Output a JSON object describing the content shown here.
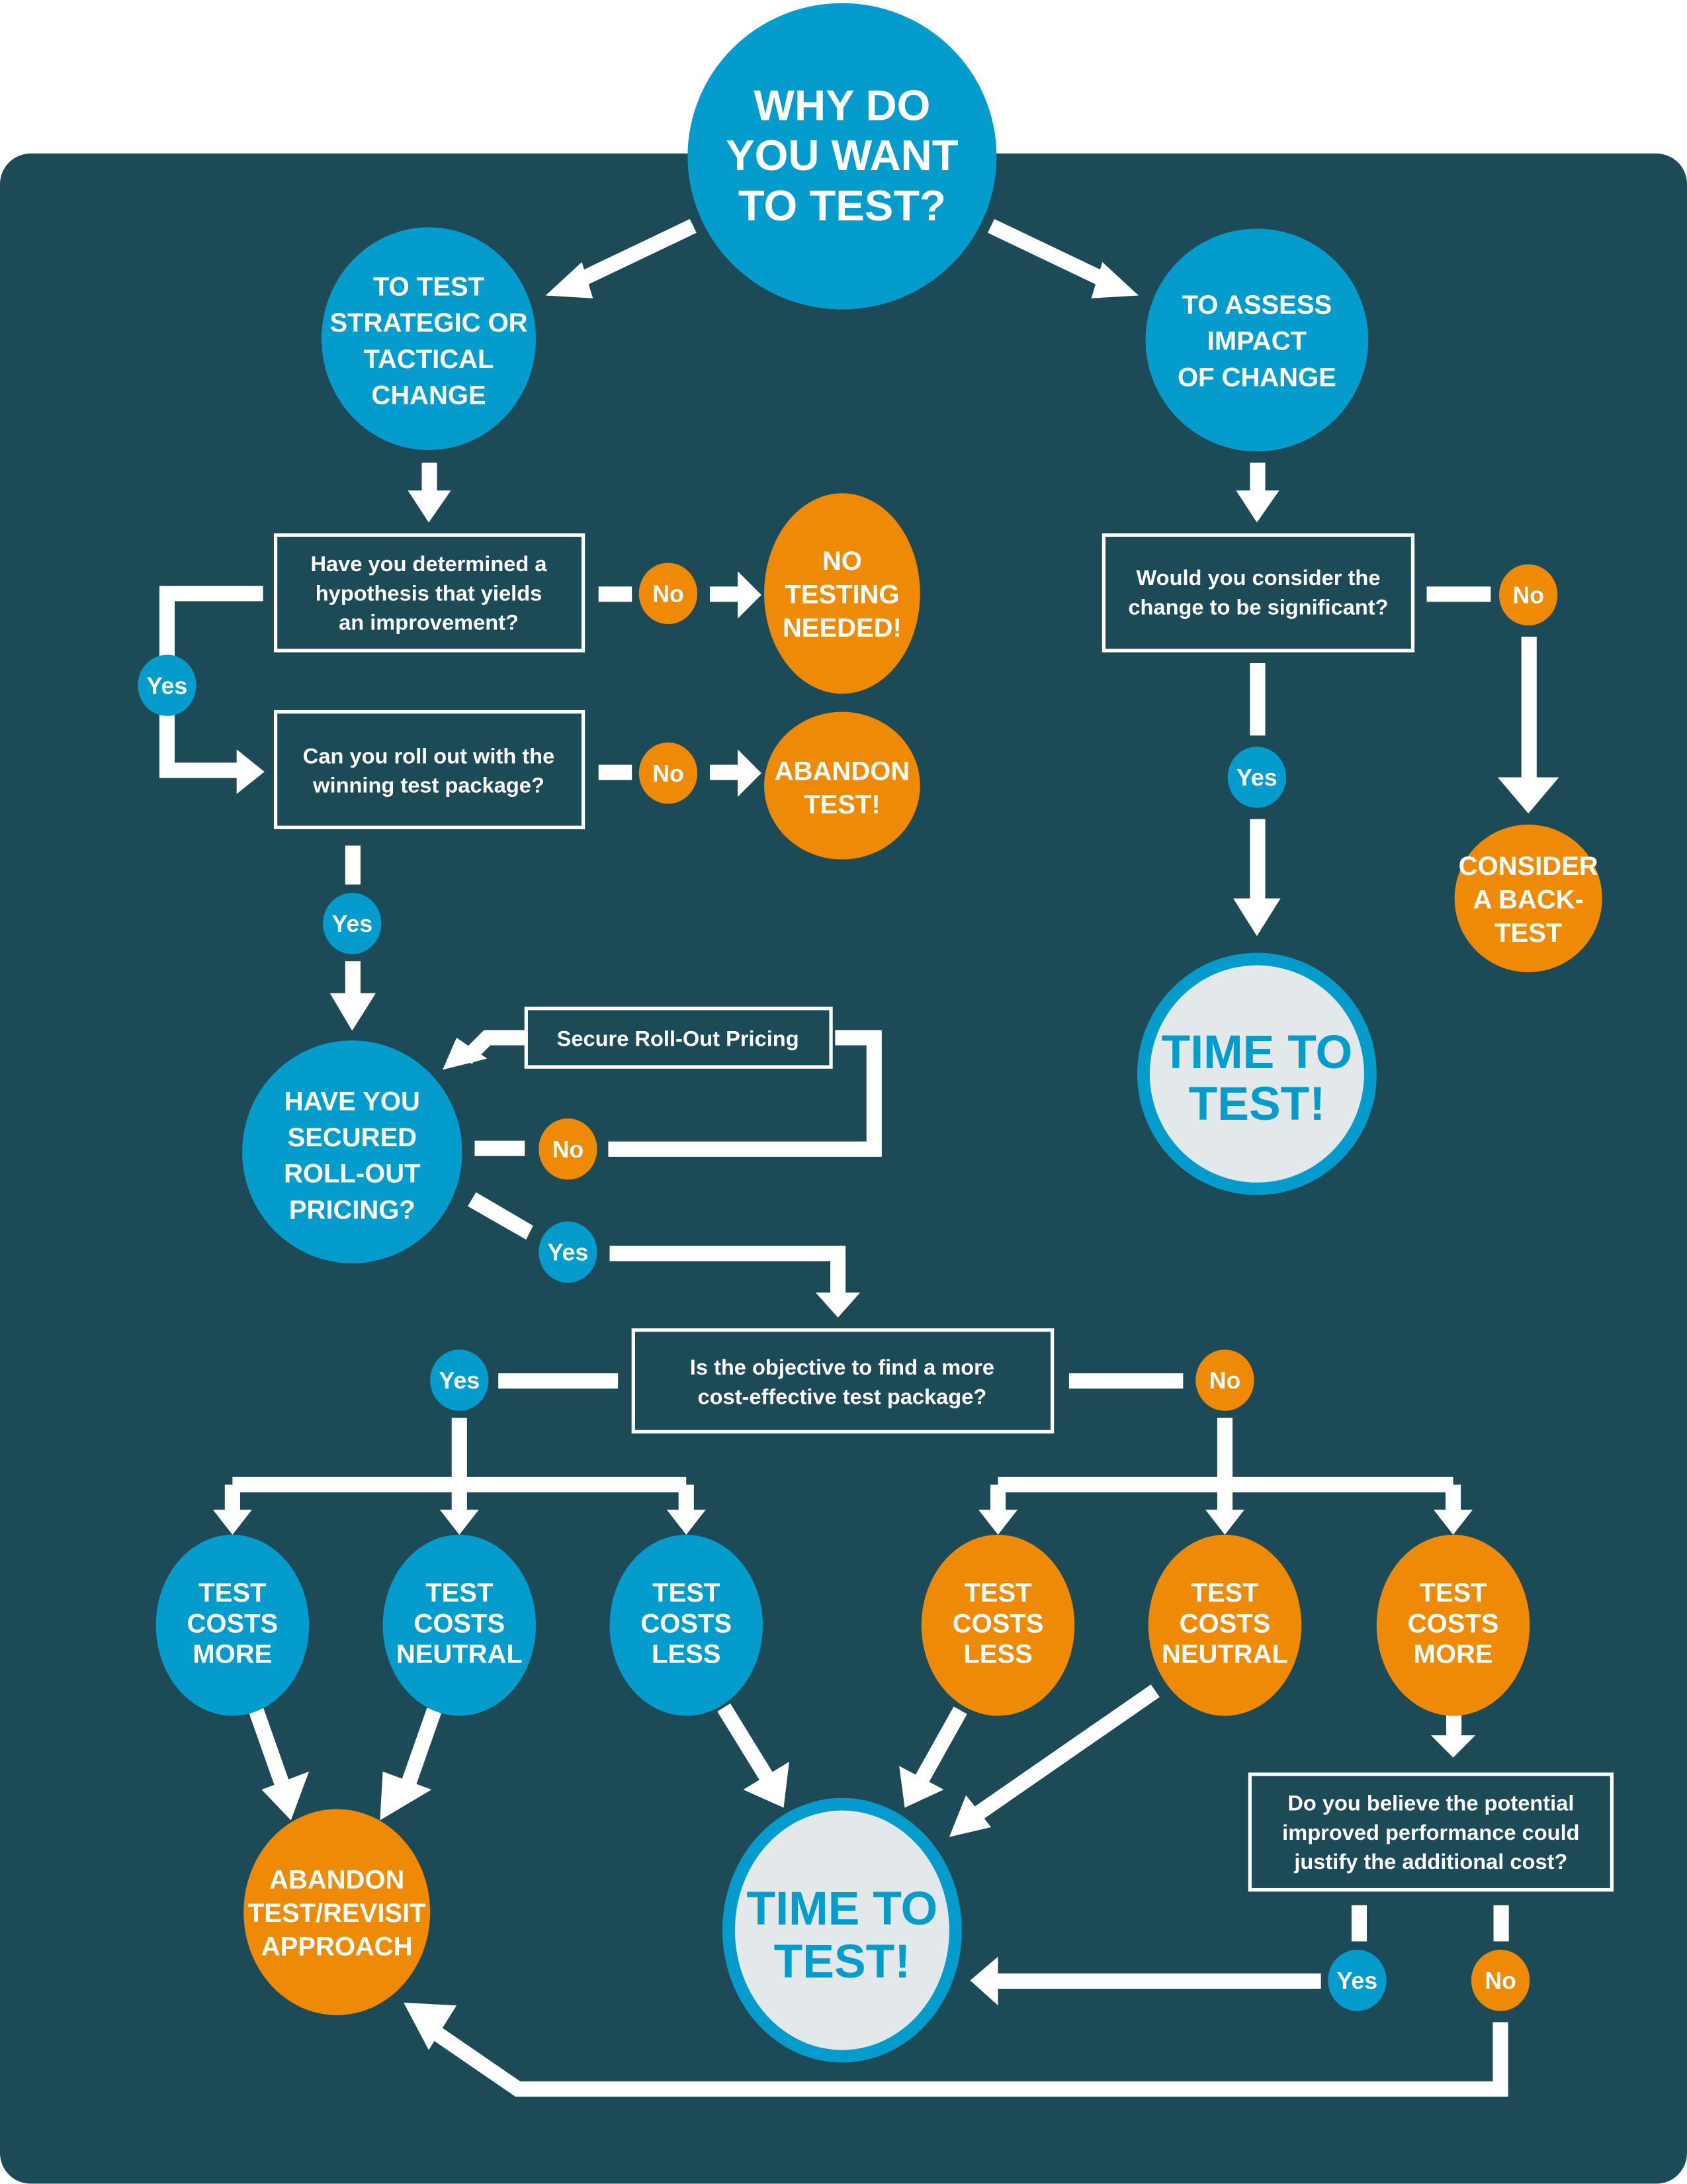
{
  "colors": {
    "background": "#1c4a57",
    "blue": "#039ccc",
    "orange": "#ef8a07",
    "light": "#e3e8eb",
    "white": "#ffffff"
  },
  "start": {
    "lines": [
      "WHY DO",
      "YOU WANT",
      "TO TEST?"
    ]
  },
  "branch_left": {
    "lines": [
      "TO TEST",
      "STRATEGIC OR",
      "TACTICAL",
      "CHANGE"
    ]
  },
  "branch_right": {
    "lines": [
      "TO ASSESS",
      "IMPACT",
      "OF CHANGE"
    ]
  },
  "q_hypothesis": {
    "lines": [
      "Have you determined a",
      "hypothesis that yields",
      "an improvement?"
    ]
  },
  "q_rollout": {
    "lines": [
      "Can you roll out with the",
      "winning test package?"
    ]
  },
  "q_significant": {
    "lines": [
      "Would you consider the",
      "change to be significant?"
    ]
  },
  "q_objective": {
    "lines": [
      "Is the objective to find a more",
      "cost-effective test package?"
    ]
  },
  "q_justify": {
    "lines": [
      "Do you believe the potential",
      "improved performance could",
      "justify the additional cost?"
    ]
  },
  "secure_box": {
    "label": "Secure Roll-Out Pricing"
  },
  "no_testing": {
    "lines": [
      "NO",
      "TESTING",
      "NEEDED!"
    ]
  },
  "abandon_test": {
    "lines": [
      "ABANDON",
      "TEST!"
    ]
  },
  "consider_backtest": {
    "lines": [
      "CONSIDER",
      "A BACK-",
      "TEST"
    ]
  },
  "time_to_test_1": {
    "lines": [
      "TIME TO",
      "TEST!"
    ]
  },
  "time_to_test_2": {
    "lines": [
      "TIME TO",
      "TEST!"
    ]
  },
  "secured_pricing": {
    "lines": [
      "HAVE YOU",
      "SECURED",
      "ROLL-OUT",
      "PRICING?"
    ]
  },
  "abandon_revisit": {
    "lines": [
      "ABANDON",
      "TEST/REVISIT",
      "APPROACH"
    ]
  },
  "blue_outcomes": [
    {
      "lines": [
        "TEST",
        "COSTS",
        "MORE"
      ]
    },
    {
      "lines": [
        "TEST",
        "COSTS",
        "NEUTRAL"
      ]
    },
    {
      "lines": [
        "TEST",
        "COSTS",
        "LESS"
      ]
    }
  ],
  "orange_outcomes": [
    {
      "lines": [
        "TEST",
        "COSTS",
        "LESS"
      ]
    },
    {
      "lines": [
        "TEST",
        "COSTS",
        "NEUTRAL"
      ]
    },
    {
      "lines": [
        "TEST",
        "COSTS",
        "MORE"
      ]
    }
  ],
  "labels": {
    "yes": "Yes",
    "no": "No"
  }
}
